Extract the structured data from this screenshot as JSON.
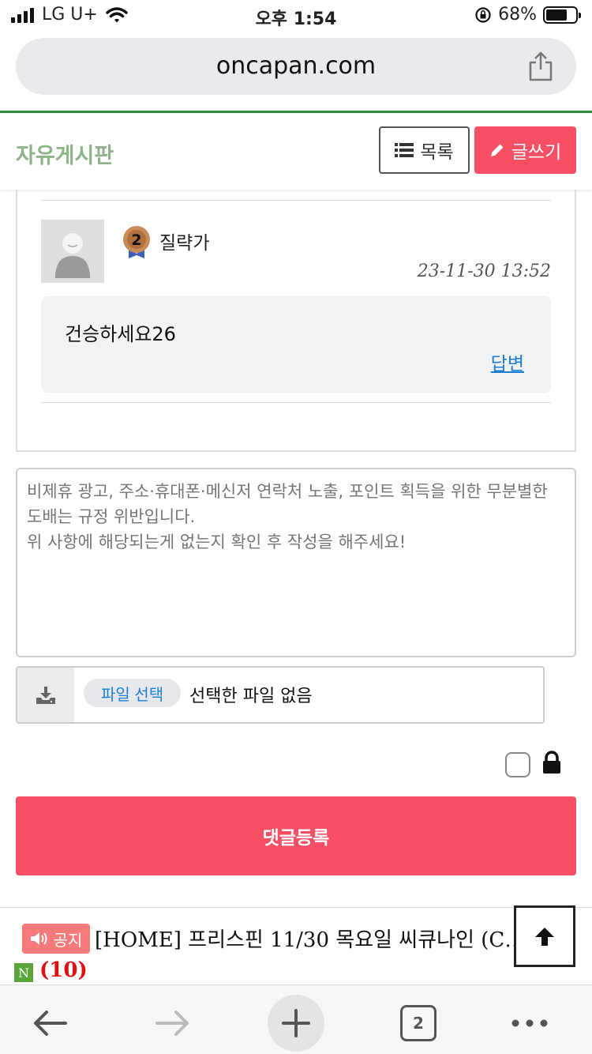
{
  "status": {
    "carrier": "LG U+",
    "time": "오후 1:54",
    "battery": "68%"
  },
  "browser": {
    "url": "oncapan.com"
  },
  "board": {
    "title": "자유게시판",
    "list_label": "목록",
    "write_label": "글쓰기"
  },
  "comment": {
    "username": "질략가",
    "level": "2",
    "datetime": "23-11-30 13:52",
    "text": "건승하세요26",
    "reply_label": "답변"
  },
  "form": {
    "placeholder": "비제휴 광고, 주소·휴대폰·메신저 연락처 노출, 포인트 획득을 위한 무분별한 도배는 규정 위반입니다.\n위 사항에 해당되는게 없는지 확인 후 작성을 해주세요!",
    "file_button": "파일 선택",
    "file_status": "선택한 파일 없음",
    "submit_label": "댓글등록"
  },
  "notice": {
    "badge": "공지",
    "title": "[HOME] 프리스핀 11/30 목요일 씨큐나인 (CQ...",
    "new_badge": "N",
    "count": "(10)"
  },
  "toolbar": {
    "tab_count": "2"
  },
  "colors": {
    "accent": "#f74f64",
    "board_title": "#8fb48a",
    "link": "#1a7fd4",
    "green_line": "#2e8b3e"
  }
}
